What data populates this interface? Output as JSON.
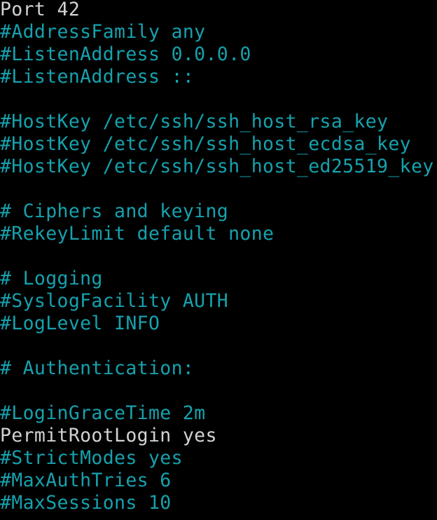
{
  "colors": {
    "background": "#000000",
    "comment_text": "#16a1ad",
    "active_text": "#d2d2d2"
  },
  "terminal": {
    "lines": [
      {
        "text": "Port 42",
        "kind": "active"
      },
      {
        "text": "#AddressFamily any",
        "kind": "comment"
      },
      {
        "text": "#ListenAddress 0.0.0.0",
        "kind": "comment"
      },
      {
        "text": "#ListenAddress ::",
        "kind": "comment"
      },
      {
        "text": "",
        "kind": "blank"
      },
      {
        "text": "#HostKey /etc/ssh/ssh_host_rsa_key",
        "kind": "comment"
      },
      {
        "text": "#HostKey /etc/ssh/ssh_host_ecdsa_key",
        "kind": "comment"
      },
      {
        "text": "#HostKey /etc/ssh/ssh_host_ed25519_key",
        "kind": "comment"
      },
      {
        "text": "",
        "kind": "blank"
      },
      {
        "text": "# Ciphers and keying",
        "kind": "comment"
      },
      {
        "text": "#RekeyLimit default none",
        "kind": "comment"
      },
      {
        "text": "",
        "kind": "blank"
      },
      {
        "text": "# Logging",
        "kind": "comment"
      },
      {
        "text": "#SyslogFacility AUTH",
        "kind": "comment"
      },
      {
        "text": "#LogLevel INFO",
        "kind": "comment"
      },
      {
        "text": "",
        "kind": "blank"
      },
      {
        "text": "# Authentication:",
        "kind": "comment"
      },
      {
        "text": "",
        "kind": "blank"
      },
      {
        "text": "#LoginGraceTime 2m",
        "kind": "comment"
      },
      {
        "text": "PermitRootLogin yes",
        "kind": "active"
      },
      {
        "text": "#StrictModes yes",
        "kind": "comment"
      },
      {
        "text": "#MaxAuthTries 6",
        "kind": "comment"
      },
      {
        "text": "#MaxSessions 10",
        "kind": "comment"
      }
    ]
  }
}
